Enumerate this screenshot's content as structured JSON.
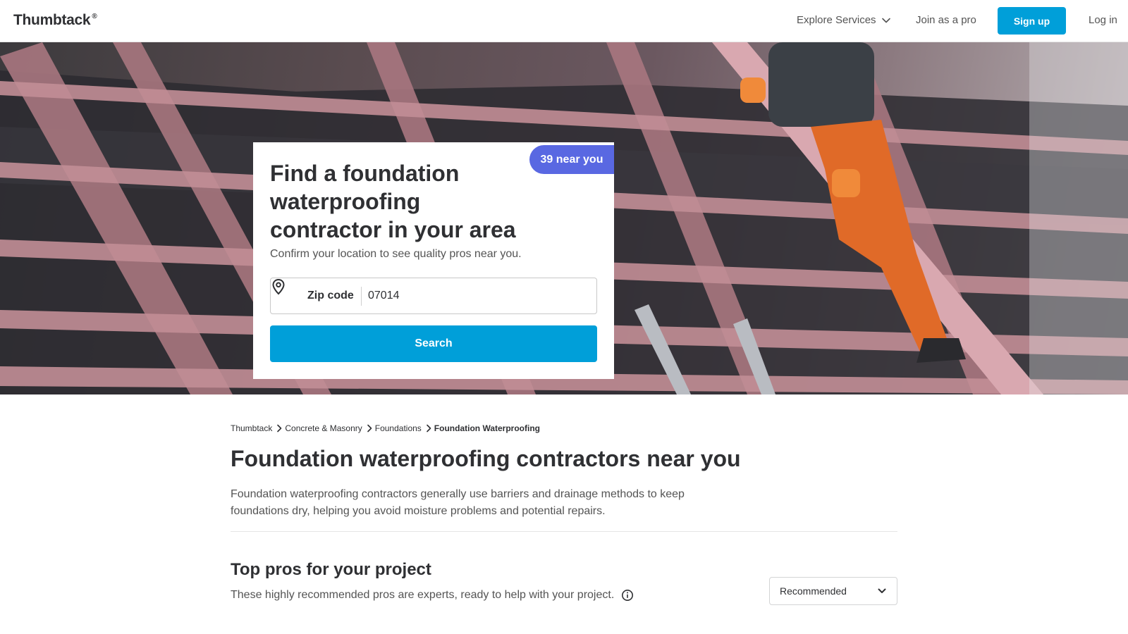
{
  "nav": {
    "logo": "Thumbtack",
    "logo_mark": "®",
    "explore_label": "Explore Services",
    "join_label": "Join as a pro",
    "signup_label": "Sign up",
    "login_label": "Log in"
  },
  "hero": {
    "title": "Find a foundation waterproofing contractor in your area",
    "badge": "39 near you",
    "subtitle": "Confirm your location to see quality pros near you.",
    "zip_label": "Zip code",
    "zip_value": "07014",
    "search_label": "Search"
  },
  "breadcrumb": {
    "items": [
      "Thumbtack",
      "Concrete & Masonry",
      "Foundations"
    ],
    "current": "Foundation Waterproofing"
  },
  "page": {
    "title": "Foundation waterproofing contractors near you",
    "description": "Foundation waterproofing contractors generally use barriers and drainage methods to keep foundations dry, helping you avoid moisture problems and potential repairs."
  },
  "top_pros": {
    "title": "Top pros for your project",
    "subtitle": "These highly recommended pros are experts, ready to help with your project.",
    "sort_value": "Recommended"
  },
  "colors": {
    "brand_blue": "#009fd9",
    "badge_purple": "#5968e2",
    "text_dark": "#2f3033",
    "text_muted": "#545454"
  },
  "icons": {
    "explore_chevron": "chevron-down-icon",
    "zip_pin": "location-pin-icon",
    "crumb_sep": "chevron-right-icon",
    "info": "info-icon",
    "sort_chevron": "chevron-down-icon"
  }
}
